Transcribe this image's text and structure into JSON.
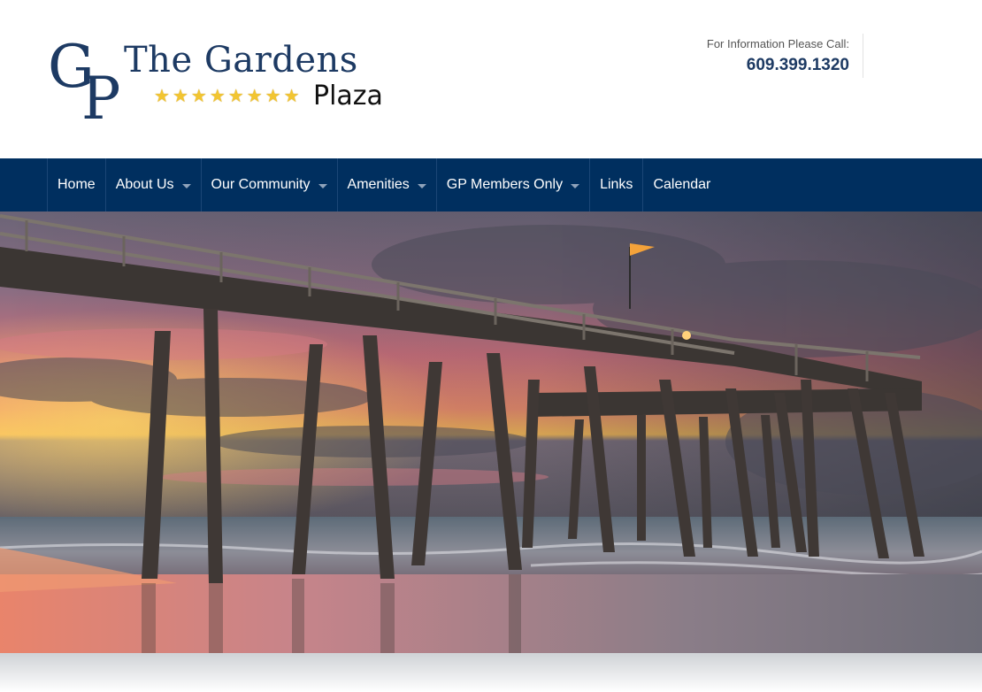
{
  "logo": {
    "monogram": "GP",
    "title": "The Gardens",
    "subtitle": "Plaza",
    "star_count": 8
  },
  "contact": {
    "label": "For Information Please Call:",
    "phone": "609.399.1320"
  },
  "nav": {
    "items": [
      {
        "label": "Home",
        "dropdown": false
      },
      {
        "label": "About Us",
        "dropdown": true
      },
      {
        "label": "Our Community",
        "dropdown": true
      },
      {
        "label": "Amenities",
        "dropdown": true
      },
      {
        "label": "GP Members Only",
        "dropdown": true
      },
      {
        "label": "Links",
        "dropdown": false
      },
      {
        "label": "Calendar",
        "dropdown": false
      }
    ]
  },
  "colors": {
    "brand_navy": "#002f5f",
    "logo_blue": "#1d3a63",
    "star_gold": "#f2c531"
  }
}
